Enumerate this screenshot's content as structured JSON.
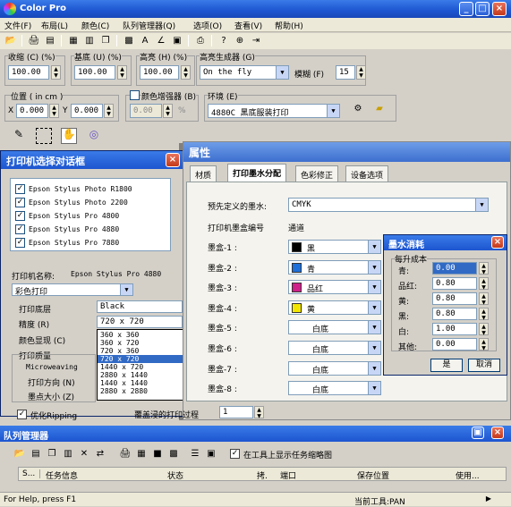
{
  "app": {
    "title": "Color Pro"
  },
  "menu": [
    "文件(F)",
    "布局(L)",
    "颜色(C)",
    "队列管理器(Q)",
    "选项(O)",
    "查看(V)",
    "帮助(H)"
  ],
  "params": {
    "saturation_label": "收缩 (C) (%)",
    "saturation_value": "100.00",
    "base_label": "基底 (U) (%)",
    "base_value": "100.00",
    "highlight_label": "高亮 (H) (%)",
    "highlight_value": "100.00",
    "generator_label": "高亮生成器 (G)",
    "generator_value": "On the fly",
    "blur_label": "模糊 (F)",
    "blur_value": "15",
    "position_label": "位置 ( in cm )",
    "x_label": "X",
    "x_value": "0.000",
    "y_label": "Y",
    "y_value": "0.000",
    "enhancer_label": "颜色增强器 (B)",
    "enhancer_value": "0.00",
    "enhancer_unit": "%",
    "env_label": "环境 (E)",
    "env_value": "4880C 黑底服装打印"
  },
  "printer_dialog": {
    "title": "打印机选择对话框",
    "printers": [
      "Epson Stylus Photo R1800",
      "Epson Stylus Photo 2200",
      "Epson Stylus Pro 4800",
      "Epson Stylus Pro 4880",
      "Epson Stylus Pro 7880"
    ],
    "name_label": "打印机名称:",
    "name_value": "Epson Stylus Pro 4880",
    "mode_value": "彩色打印",
    "base_layer_label": "打印底层",
    "base_layer_value": "Black",
    "precision_label": "精度 (R)",
    "precision_value": "720 x 720",
    "precision_options": [
      "360 x 360",
      "360 x 720",
      "720 x 360",
      "720 x 720",
      "1440 x 720",
      "2880 x 1440",
      "1440 x 1440",
      "2880 x 2880"
    ],
    "color_display_label": "颜色显现 (C)",
    "quality_label": "打印质量",
    "microweaving_label": "Microweaving",
    "direction_label": "打印方向 (N)",
    "dot_size_label": "墨点大小 (Z)",
    "optimize_label": "优化Ripping",
    "overlap_label": "覆盖浸的打印过程",
    "overlap_value": "1"
  },
  "properties": {
    "title": "属性",
    "tabs": [
      "材质",
      "打印墨水分配",
      "色彩修正",
      "设备选项"
    ],
    "preset_label": "预先定义的墨水:",
    "preset_value": "CMYK",
    "col_cartridge": "打印机墨盒编号",
    "col_channel": "通道",
    "cartridges": [
      {
        "label": "墨盒-1 :",
        "value": "黑",
        "color": "#000000"
      },
      {
        "label": "墨盒-2 :",
        "value": "青",
        "color": "#1e6fd9"
      },
      {
        "label": "墨盒-3 :",
        "value": "品红",
        "color": "#d0208a"
      },
      {
        "label": "墨盒-4 :",
        "value": "黄",
        "color": "#f2e600"
      },
      {
        "label": "墨盒-5 :",
        "value": "白底",
        "color": ""
      },
      {
        "label": "墨盒-6 :",
        "value": "白底",
        "color": ""
      },
      {
        "label": "墨盒-7 :",
        "value": "白底",
        "color": ""
      },
      {
        "label": "墨盒-8 :",
        "value": "白底",
        "color": ""
      }
    ]
  },
  "ink_cost": {
    "title": "墨水消耗",
    "group_label": "每升成本",
    "rows": [
      {
        "label": "青:",
        "value": "0.00"
      },
      {
        "label": "品红:",
        "value": "0.80"
      },
      {
        "label": "黄:",
        "value": "0.80"
      },
      {
        "label": "黑:",
        "value": "0.80"
      },
      {
        "label": "白:",
        "value": "1.00"
      },
      {
        "label": "其他:",
        "value": "0.00"
      }
    ],
    "ok": "是",
    "cancel": "取消"
  },
  "queue": {
    "title": "队列管理器",
    "show_thumb_label": "在工具上显示任务缩略图",
    "columns": [
      "S...",
      "任务信息",
      "状态",
      "拷.",
      "端口",
      "保存位置",
      "使用..."
    ]
  },
  "status": {
    "help": "For Help, press F1",
    "tool": "当前工具:PAN"
  }
}
